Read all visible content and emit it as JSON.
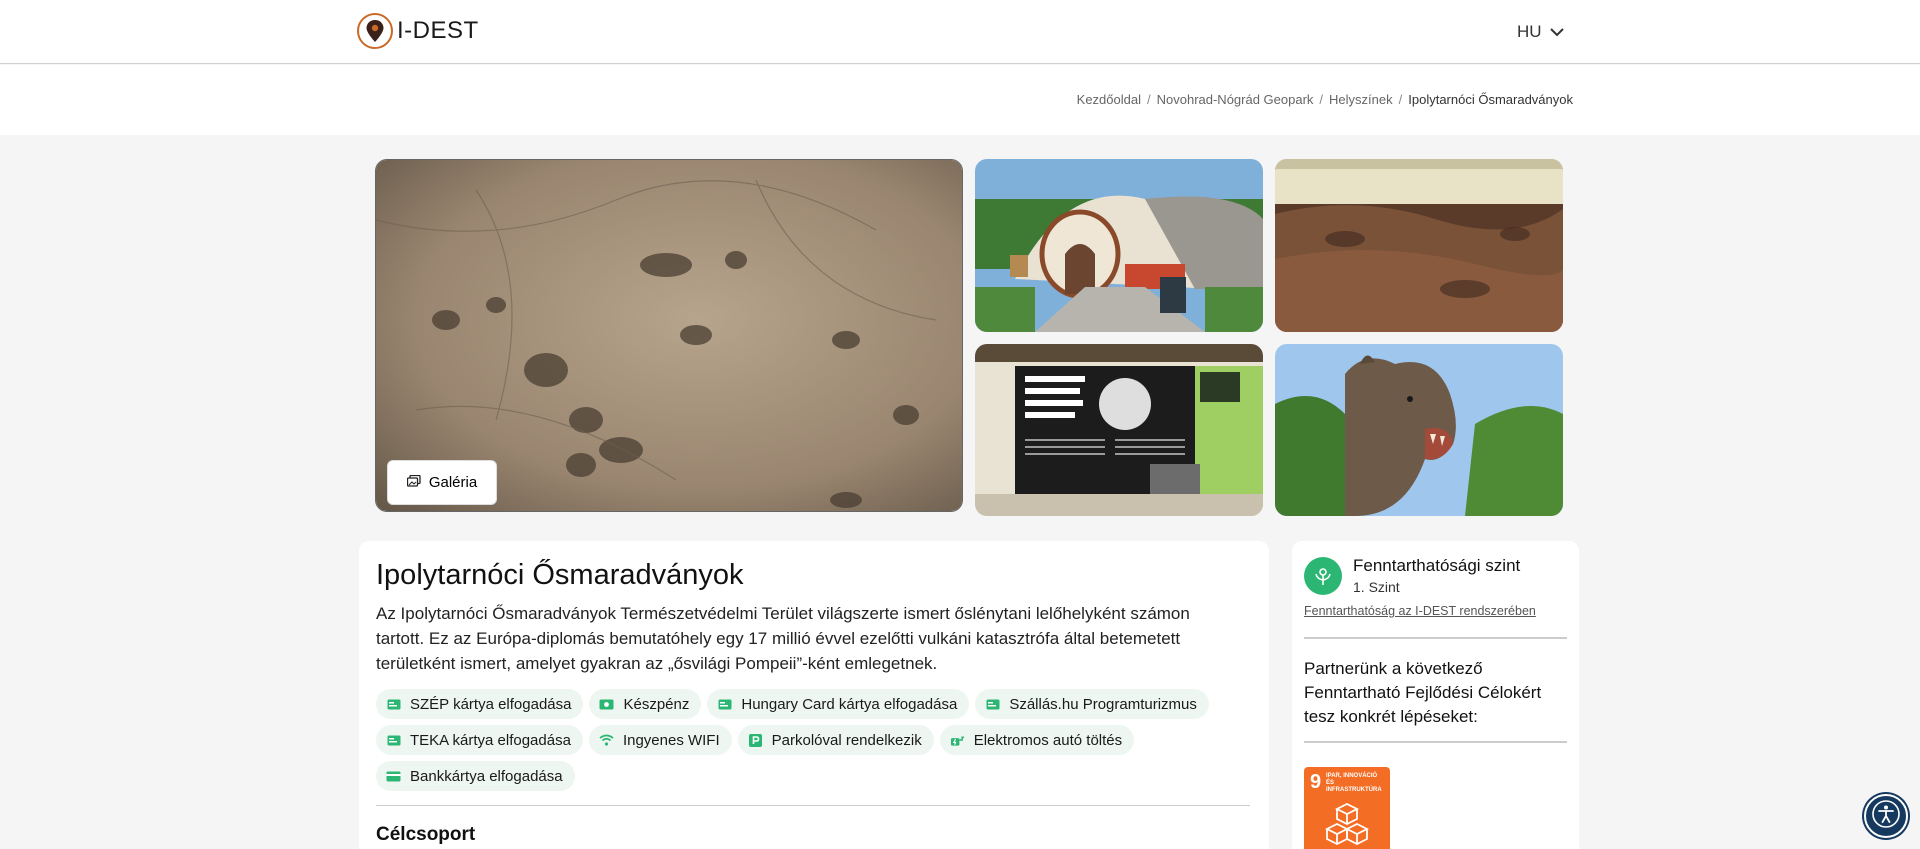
{
  "header": {
    "logo_text": "I-DEST",
    "language": "HU"
  },
  "breadcrumb": {
    "items": [
      "Kezdőoldal",
      "Novohrad-Nógrád Geopark",
      "Helyszínek"
    ],
    "current": "Ipolytarnóci Ősmaradványok"
  },
  "gallery": {
    "button_label": "Galéria"
  },
  "place": {
    "title": "Ipolytarnóci Ősmaradványok",
    "description": "Az Ipolytarnóci Ősmaradványok Természetvédelmi Terület világszerte ismert őslénytani lelőhelyként számon tartott. Ez az Európa-diplomás bemutatóhely egy 17 millió évvel ezelőtti vulkáni katasztrófa által betemetett területként ismert, amelyet gyakran az „ősvilági Pompeii”-ként emlegetnek.",
    "tags": [
      {
        "label": "SZÉP kártya elfogadása",
        "icon": "card-icon"
      },
      {
        "label": "Készpénz",
        "icon": "cash-icon"
      },
      {
        "label": "Hungary Card kártya elfogadása",
        "icon": "card-icon"
      },
      {
        "label": "Szállás.hu Programturizmus",
        "icon": "card-icon"
      },
      {
        "label": "TEKA kártya elfogadása",
        "icon": "card-icon"
      },
      {
        "label": "Ingyenes WIFI",
        "icon": "wifi-icon"
      },
      {
        "label": "Parkolóval rendelkezik",
        "icon": "parking-icon"
      },
      {
        "label": "Elektromos autó töltés",
        "icon": "ev-charging-icon"
      },
      {
        "label": "Bankkártya elfogadása",
        "icon": "credit-card-icon"
      }
    ],
    "section_title": "Célcsoport"
  },
  "sustainability": {
    "title": "Fenntarthatósági szint",
    "level": "1. Szint",
    "link": "Fenntarthatóság az I-DEST rendszerében",
    "partner_text": "Partnerünk a következő Fenntartható Fejlődési Célokért tesz konkrét lépéseket:",
    "sdg_number": "9",
    "sdg_label": "IPAR, INNOVÁCIÓ ÉS INFRASTRUKTÚRA"
  },
  "colors": {
    "accent_green": "#2cb673",
    "tag_bg": "#eef6f1",
    "sdg_orange": "#f36d25",
    "logo_brown": "#c96a28",
    "a11y_navy": "#163a5f"
  }
}
